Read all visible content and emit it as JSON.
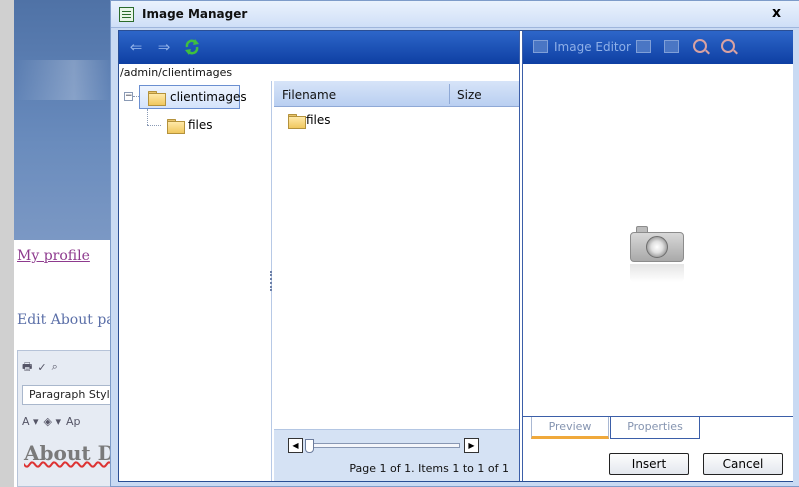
{
  "background": {
    "profile_link": "My profile",
    "edit_text": "Edit About pag",
    "paragraph_style": "Paragraph Style",
    "toolbar_row2_text": "Ap",
    "heading_text": "About D"
  },
  "dialog": {
    "title": "Image Manager",
    "close_glyph": "x",
    "path": "/admin/clientimages",
    "tree": {
      "root_label": "clientimages",
      "children": [
        {
          "label": "files"
        }
      ]
    },
    "grid": {
      "col_filename": "Filename",
      "col_size": "Size",
      "rows": [
        {
          "name": "files",
          "size": ""
        }
      ]
    },
    "pager": {
      "info": "Page 1 of 1. Items 1 to 1 of 1"
    },
    "editor": {
      "image_editor_label": "Image Editor"
    },
    "tabs": {
      "preview": "Preview",
      "properties": "Properties"
    },
    "buttons": {
      "insert": "Insert",
      "cancel": "Cancel"
    },
    "icons": {
      "back": "left-arrow-icon",
      "forward": "right-arrow-icon",
      "refresh": "refresh-icon",
      "camera": "camera-icon"
    }
  },
  "colors": {
    "toolbar_blue": "#0e3fa3",
    "tab_active_accent": "#f0a93b",
    "link_visited": "#8e3a8e"
  }
}
